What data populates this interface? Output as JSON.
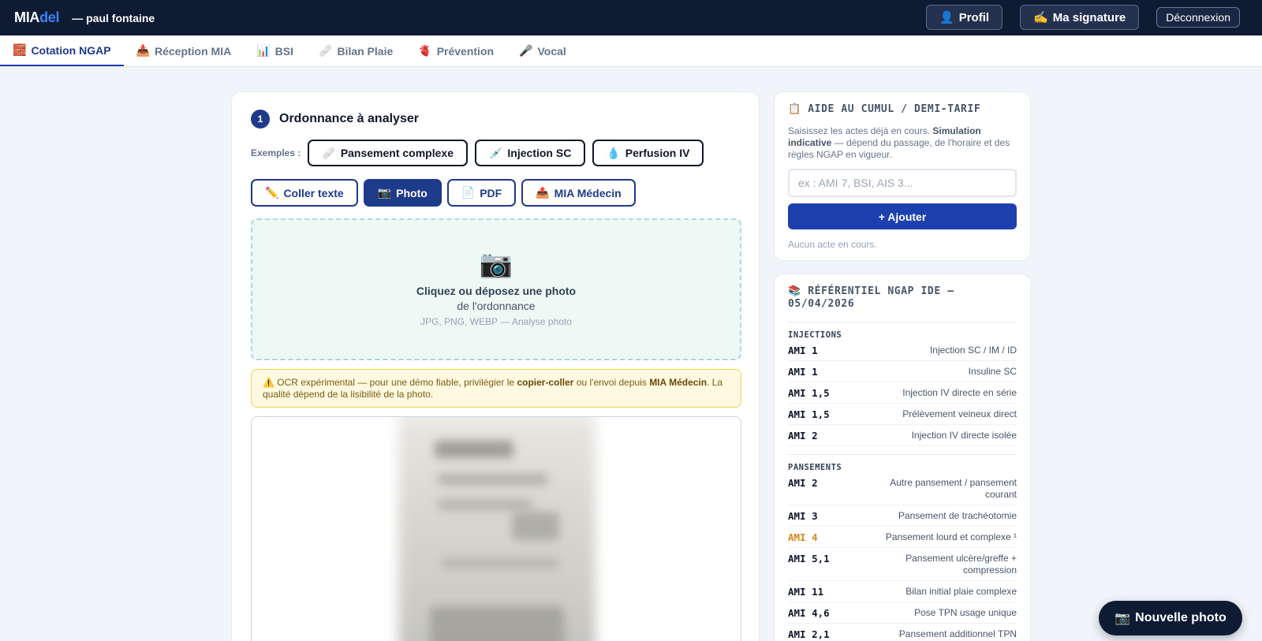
{
  "header": {
    "logo_main": "MIA",
    "logo_accent": "del",
    "user": "— paul fontaine",
    "profile_icon": "👤",
    "profile_label": "Profil",
    "signature_icon": "✍️",
    "signature_label": "Ma signature",
    "logout_label": "Déconnexion"
  },
  "tabs": [
    {
      "icon": "🧱",
      "label": "Cotation NGAP",
      "active": true
    },
    {
      "icon": "📥",
      "label": "Réception MIA"
    },
    {
      "icon": "📊",
      "label": "BSI"
    },
    {
      "icon": "🩹",
      "label": "Bilan Plaie"
    },
    {
      "icon": "🫀",
      "label": "Prévention"
    },
    {
      "icon": "🎤",
      "label": "Vocal"
    }
  ],
  "main": {
    "step_number": "1",
    "step_title": "Ordonnance à analyser",
    "examples_label": "Exemples :",
    "examples": [
      {
        "icon": "🩹",
        "label": "Pansement complexe"
      },
      {
        "icon": "💉",
        "label": "Injection SC"
      },
      {
        "icon": "💧",
        "label": "Perfusion IV"
      }
    ],
    "modes": [
      {
        "icon": "✏️",
        "label": "Coller texte"
      },
      {
        "icon": "📷",
        "label": "Photo",
        "active": true
      },
      {
        "icon": "📄",
        "label": "PDF"
      },
      {
        "icon": "📤",
        "label": "MIA Médecin"
      }
    ],
    "dropzone": {
      "icon": "📷",
      "main": "Cliquez ou déposez une photo",
      "sub": "de l'ordonnance",
      "hint": "JPG, PNG, WEBP — Analyse photo"
    },
    "warning": {
      "icon": "⚠️",
      "text_1": "OCR expérimental — pour une démo fiable, privilégier le ",
      "bold_1": "copier-coller",
      "text_2": " ou l'envoi depuis ",
      "bold_2": "MIA Médecin",
      "text_3": ". La qualité dépend de la lisibilité de la photo."
    }
  },
  "cumul": {
    "icon": "📋",
    "title": "AIDE AU CUMUL / DEMI-TARIF",
    "desc_1": "Saisissez les actes déjà en cours. ",
    "desc_bold": "Simulation indicative",
    "desc_2": " — dépend du passage, de l'horaire et des règles NGAP en vigueur.",
    "input_placeholder": "ex : AMI 7, BSI, AIS 3...",
    "add_label": "+ Ajouter",
    "empty": "Aucun acte en cours."
  },
  "referentiel": {
    "icon": "📚",
    "title": "RÉFÉRENTIEL NGAP IDE — 05/04/2026",
    "groups": [
      {
        "name": "INJECTIONS",
        "rows": [
          {
            "code": "AMI 1",
            "label": "Injection SC / IM / ID"
          },
          {
            "code": "AMI 1",
            "label": "Insuline SC"
          },
          {
            "code": "AMI 1,5",
            "label": "Injection IV directe en série"
          },
          {
            "code": "AMI 1,5",
            "label": "Prélèvement veineux direct"
          },
          {
            "code": "AMI 2",
            "label": "Injection IV directe isolée"
          }
        ]
      },
      {
        "name": "PANSEMENTS",
        "rows": [
          {
            "code": "AMI 2",
            "label": "Autre pansement / pansement courant"
          },
          {
            "code": "AMI 3",
            "label": "Pansement de trachéotomie"
          },
          {
            "code": "AMI 4",
            "label": "Pansement lourd et complexe ¹",
            "highlight": true
          },
          {
            "code": "AMI 5,1",
            "label": "Pansement ulcère/greffe + compression"
          },
          {
            "code": "AMI 11",
            "label": "Bilan initial plaie complexe"
          },
          {
            "code": "AMI 4,6",
            "label": "Pose TPN usage unique"
          },
          {
            "code": "AMI 2,1",
            "label": "Pansement additionnel TPN"
          }
        ]
      }
    ]
  },
  "fab": {
    "icon": "📷",
    "label": "Nouvelle photo"
  }
}
